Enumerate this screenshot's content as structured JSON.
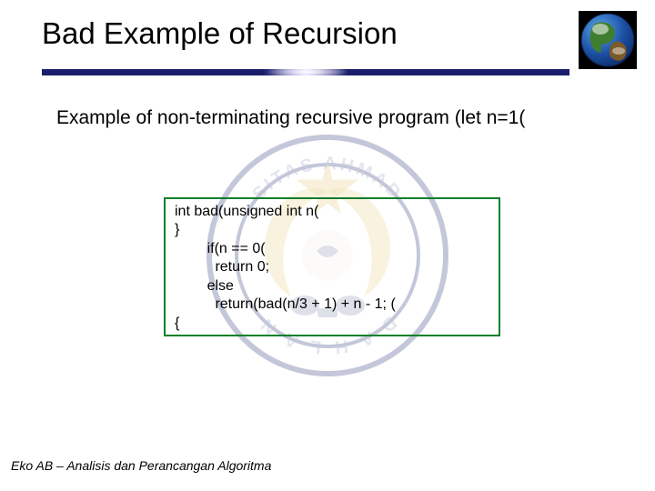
{
  "slide": {
    "title": "Bad Example of Recursion",
    "subtitle": "Example of non-terminating recursive program (let n=1(",
    "code": {
      "line1": "int bad(unsigned int n(",
      "line2": "}",
      "line3": "        if(n == 0(",
      "line4": "          return 0;",
      "line5": "        else",
      "line6": "          return(bad(n/3 + 1) + n - 1; (",
      "line7": "{"
    },
    "footer": "Eko AB – Analisis dan Perancangan Algoritma"
  },
  "icons": {
    "globe": "globe-icon",
    "watermark": "university-seal"
  }
}
